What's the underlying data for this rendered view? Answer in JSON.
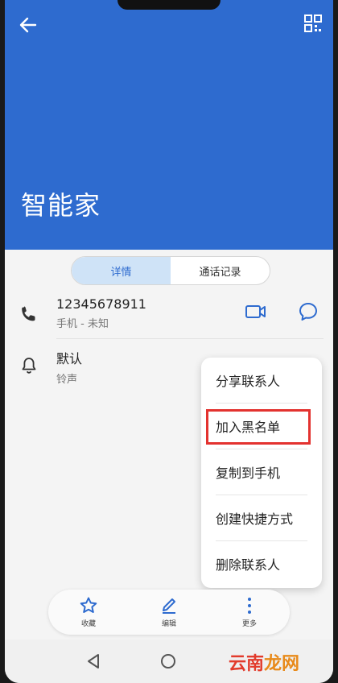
{
  "contact": {
    "name": "智能家"
  },
  "tabs": [
    {
      "label": "详情"
    },
    {
      "label": "通话记录"
    }
  ],
  "phone": {
    "number": "12345678911",
    "type": "手机 - 未知"
  },
  "ringtone": {
    "value": "默认",
    "label": "铃声"
  },
  "menu": {
    "items": [
      "分享联系人",
      "加入黑名单",
      "复制到手机",
      "创建快捷方式",
      "删除联系人"
    ],
    "highlighted": "加入黑名单"
  },
  "bottom_bar": {
    "items": [
      {
        "label": "收藏",
        "icon": "star-icon"
      },
      {
        "label": "编辑",
        "icon": "edit-icon"
      },
      {
        "label": "更多",
        "icon": "more-icon"
      }
    ]
  },
  "watermark": {
    "part1": "云南",
    "part2": "龙网"
  },
  "colors": {
    "header": "#2e6bcf",
    "accent": "#2e6bcf",
    "highlight": "#e3322f"
  }
}
